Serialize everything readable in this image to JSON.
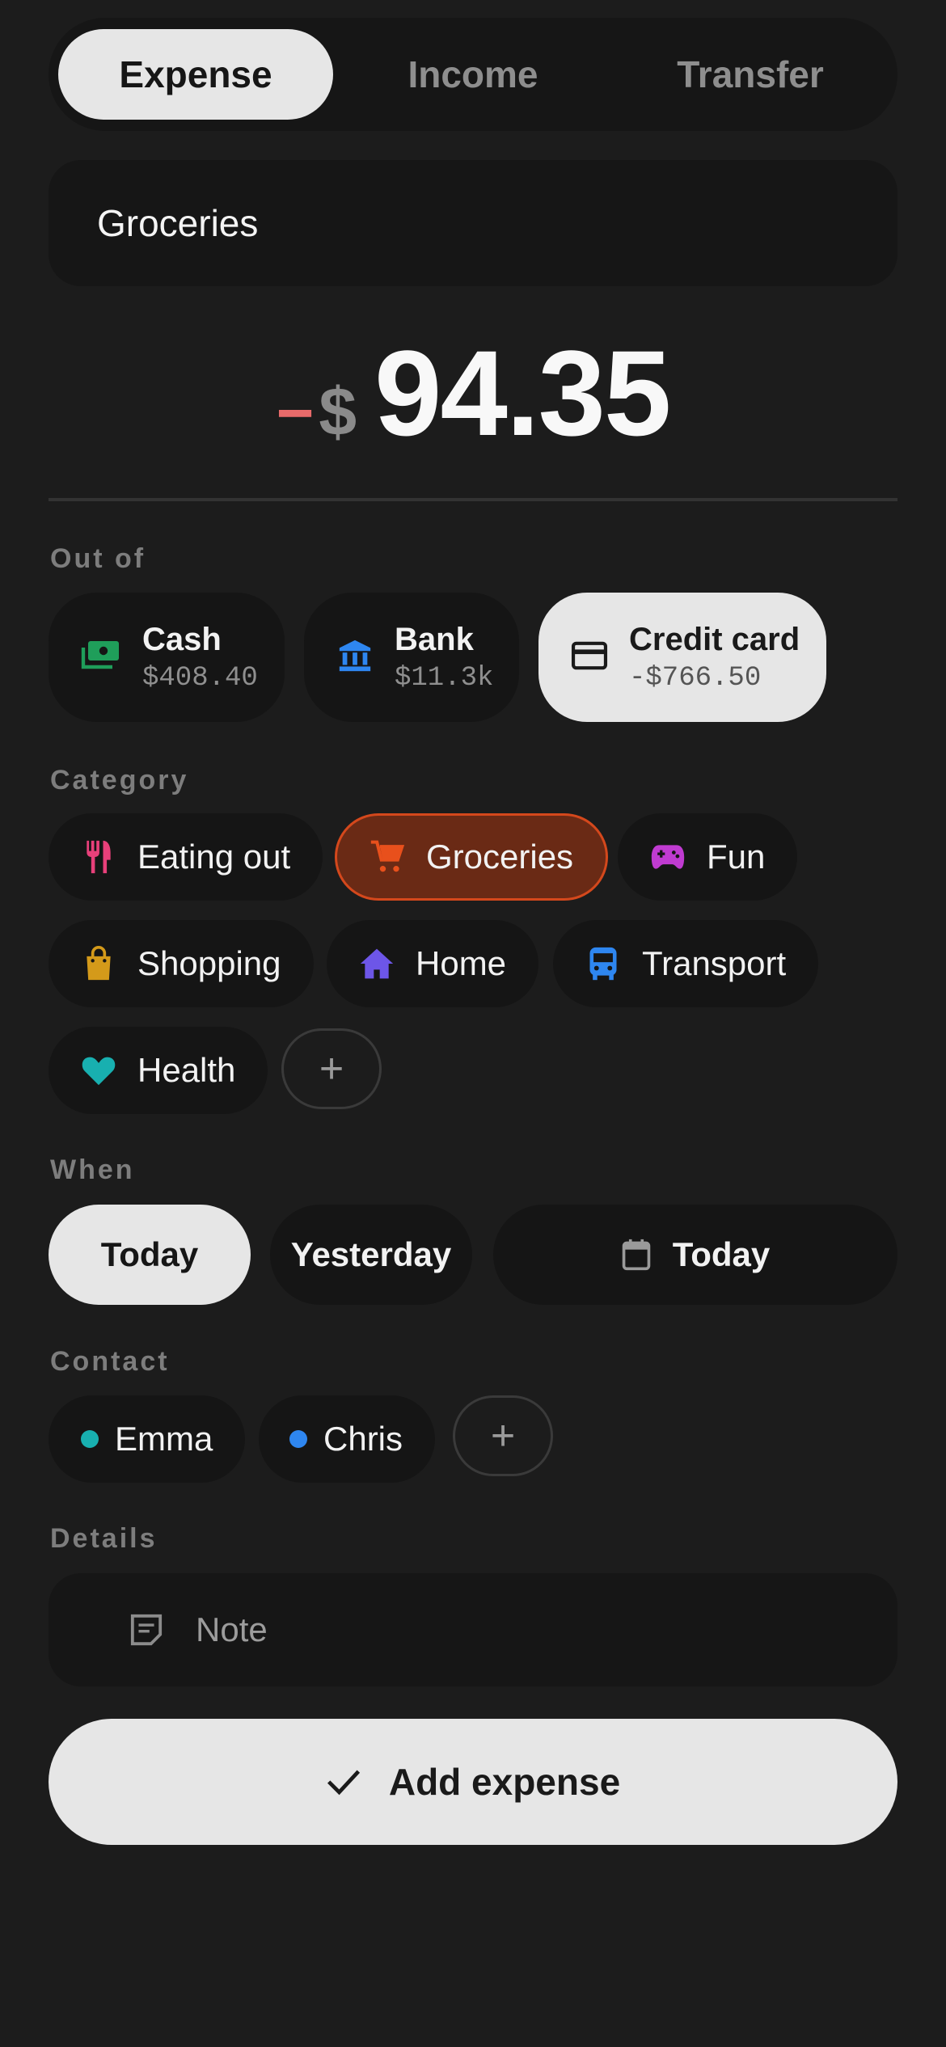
{
  "tabs": [
    {
      "label": "Expense",
      "active": true
    },
    {
      "label": "Income",
      "active": false
    },
    {
      "label": "Transfer",
      "active": false
    }
  ],
  "title_field": {
    "value": "Groceries"
  },
  "amount": {
    "sign": "−",
    "currency": "$",
    "value": "94.35",
    "sign_color": "#e86a6a"
  },
  "sections": {
    "out_of": "Out of",
    "category": "Category",
    "when": "When",
    "contact": "Contact",
    "details": "Details"
  },
  "accounts": [
    {
      "name": "Cash",
      "balance": "$408.40",
      "icon": "cash-icon",
      "color": "#1f9e5a",
      "selected": false
    },
    {
      "name": "Bank",
      "balance": "$11.3k",
      "icon": "bank-icon",
      "color": "#2e86f0",
      "selected": false
    },
    {
      "name": "Credit card",
      "balance": "-$766.50",
      "icon": "credit-card-icon",
      "color": "#1a1a1a",
      "selected": true
    }
  ],
  "categories": [
    {
      "label": "Eating out",
      "icon": "fork-knife-icon",
      "color": "#e8407a",
      "selected": false
    },
    {
      "label": "Groceries",
      "icon": "cart-icon",
      "color": "#e8501c",
      "selected": true
    },
    {
      "label": "Fun",
      "icon": "gamepad-icon",
      "color": "#c03bd1",
      "selected": false
    },
    {
      "label": "Shopping",
      "icon": "shopping-bag-icon",
      "color": "#d49a1a",
      "selected": false
    },
    {
      "label": "Home",
      "icon": "house-icon",
      "color": "#6d56e8",
      "selected": false
    },
    {
      "label": "Transport",
      "icon": "bus-icon",
      "color": "#2e86f0",
      "selected": false
    },
    {
      "label": "Health",
      "icon": "heart-icon",
      "color": "#18b0b0",
      "selected": false
    }
  ],
  "add_symbol": "+",
  "when": [
    {
      "label": "Today",
      "selected": true
    },
    {
      "label": "Yesterday",
      "selected": false
    },
    {
      "label": "Today",
      "icon": "calendar-icon",
      "selected": false
    }
  ],
  "contacts": [
    {
      "name": "Emma",
      "color": "#18b0b0"
    },
    {
      "name": "Chris",
      "color": "#2e86f0"
    }
  ],
  "note": {
    "placeholder": "Note",
    "icon": "note-icon"
  },
  "submit": {
    "label": "Add expense",
    "icon": "check-icon"
  }
}
